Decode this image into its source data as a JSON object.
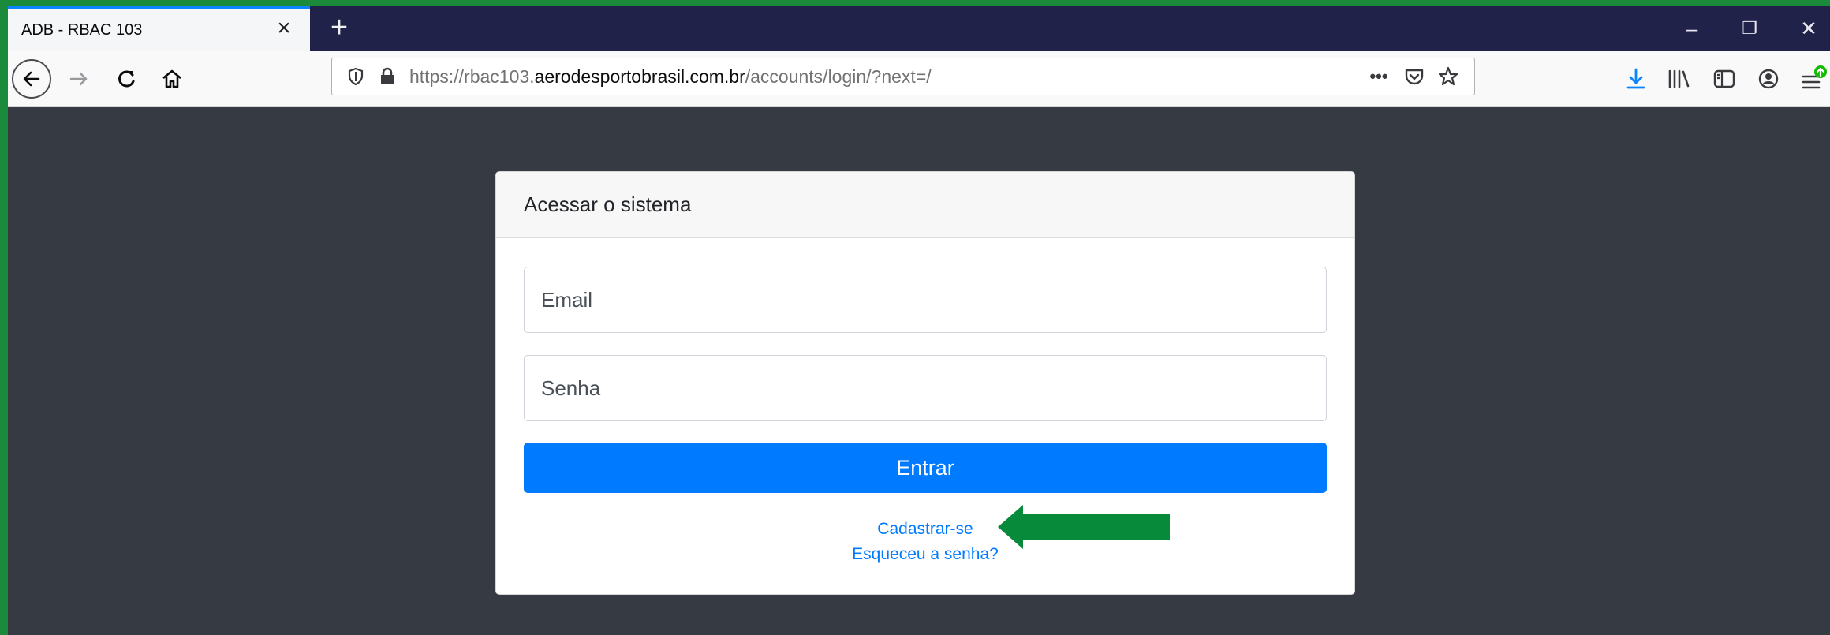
{
  "browser": {
    "tab_title": "ADB - RBAC 103",
    "tab_close": "×",
    "new_tab": "+",
    "url_prefix": "https://rbac103.",
    "url_domain": "aerodesportobrasil.com.br",
    "url_path": "/accounts/login/?next=/",
    "page_actions_label": "•••",
    "window_controls": {
      "minimize": "–",
      "maximize": "❐",
      "close": "✕"
    }
  },
  "login": {
    "title": "Acessar o sistema",
    "email_placeholder": "Email",
    "password_placeholder": "Senha",
    "submit_label": "Entrar",
    "register_link": "Cadastrar-se",
    "forgot_link": "Esqueceu a senha?"
  },
  "colors": {
    "primary": "#007bff",
    "page_background": "#363a42",
    "annotation_arrow": "#078a3a",
    "tabbar": "#21224a"
  },
  "icons": [
    "back-icon",
    "forward-icon",
    "reload-icon",
    "home-icon",
    "shield-icon",
    "lock-icon",
    "page-actions-icon",
    "pocket-icon",
    "bookmark-star-icon",
    "download-icon",
    "library-icon",
    "sidebar-icon",
    "account-icon",
    "menu-icon"
  ]
}
